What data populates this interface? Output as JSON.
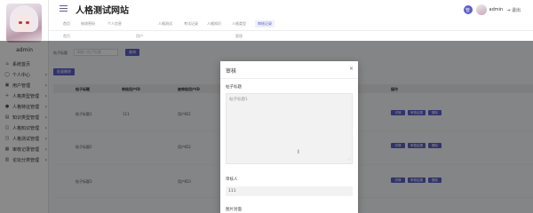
{
  "header": {
    "site_title": "人格测试网站",
    "badge_letter": "管",
    "user_name": "admin",
    "logout_label": "退出"
  },
  "sidebar": {
    "admin_name": "admin",
    "items": [
      {
        "icon": "⌂",
        "label": "系统首页",
        "chev": ""
      },
      {
        "icon": "◯",
        "label": "个人中心",
        "chev": "›"
      },
      {
        "icon": "▣",
        "label": "用户管理",
        "chev": "›"
      },
      {
        "icon": "+",
        "label": "人格类型管理",
        "chev": "›"
      },
      {
        "icon": "●",
        "label": "人格特征管理",
        "chev": "›"
      },
      {
        "icon": "▤",
        "label": "知识类型管理",
        "chev": "›"
      },
      {
        "icon": "◫",
        "label": "人格知识管理",
        "chev": "›"
      },
      {
        "icon": "◳",
        "label": "人格测试管理",
        "chev": "›"
      },
      {
        "icon": "▦",
        "label": "审核记录管理",
        "chev": "›"
      },
      {
        "icon": "▥",
        "label": "论坛分类管理",
        "chev": "›"
      }
    ]
  },
  "tabs": [
    {
      "label": "首页",
      "active": false
    },
    {
      "label": "修改密码",
      "active": false
    },
    {
      "label": "个人信息",
      "active": false
    },
    {
      "label": "人格测试",
      "active": false
    },
    {
      "label": "考试记录",
      "active": false
    },
    {
      "label": "人格知识",
      "active": false
    },
    {
      "label": "人格类型",
      "active": false
    },
    {
      "label": "审核记录",
      "active": true
    }
  ],
  "breadcrumb": [
    {
      "label": "首页"
    },
    {
      "label": "用户"
    },
    {
      "label": "管理"
    }
  ],
  "toolbar": {
    "search_label": "帖子标题",
    "search_placeholder": "请输入帖子标题",
    "search_button": "查询",
    "batch_delete_button": "批量删除"
  },
  "table": {
    "headers": [
      "帖子标题",
      "审核用户ID",
      "被审核用户ID",
      "操作"
    ],
    "rows": [
      {
        "title": "帖子标题1",
        "reviewer": "111",
        "reviewed": "用户ID1"
      },
      {
        "title": "帖子标题2",
        "reviewer": "",
        "reviewed": "用户ID2"
      },
      {
        "title": "帖子标题3",
        "reviewer": "",
        "reviewed": "用户ID3"
      }
    ],
    "action_labels": [
      "详情",
      "审核结果",
      "删除"
    ]
  },
  "modal": {
    "title": "审核",
    "close_glyph": "×",
    "field_post_title_label": "帖子标题",
    "post_title_value": "帖子标题1",
    "reviewer_label": "审核人",
    "reviewer_value": "111",
    "next_label": "图片封面"
  }
}
